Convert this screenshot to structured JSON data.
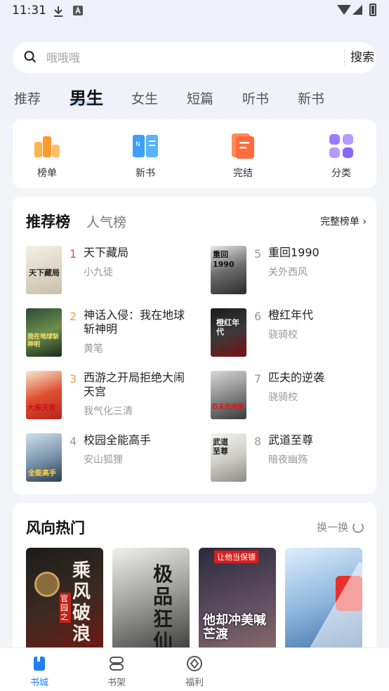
{
  "status_bar": {
    "time": "11:31"
  },
  "search": {
    "placeholder": "哦哦哦",
    "button": "搜索"
  },
  "tabs": [
    {
      "label": "推荐"
    },
    {
      "label": "男生",
      "active": true
    },
    {
      "label": "女生"
    },
    {
      "label": "短篇"
    },
    {
      "label": "听书"
    },
    {
      "label": "新书"
    }
  ],
  "quick_entries": [
    {
      "label": "榜单",
      "icon": "ranking-icon"
    },
    {
      "label": "新书",
      "icon": "new-book-icon"
    },
    {
      "label": "完结",
      "icon": "finished-icon"
    },
    {
      "label": "分类",
      "icon": "category-icon"
    }
  ],
  "ranking": {
    "tab_active": "推荐榜",
    "tab_other": "人气榜",
    "full_list": "完整榜单",
    "books": [
      {
        "rank": "1",
        "title": "天下藏局",
        "author": "小九徒",
        "cover_text": "天下藏局"
      },
      {
        "rank": "2",
        "title": "神话入侵：我在地球斩神明",
        "author": "黄笔",
        "cover_text": "我在地球斩神明"
      },
      {
        "rank": "3",
        "title": "西游之开局拒绝大闹天宫",
        "author": "我气化三清",
        "cover_text": "大闹天宫"
      },
      {
        "rank": "4",
        "title": "校园全能高手",
        "author": "安山狐狸",
        "cover_text": "全能高手"
      },
      {
        "rank": "5",
        "title": "重回1990",
        "author": "关外西风",
        "cover_text": "重回1990"
      },
      {
        "rank": "6",
        "title": "橙红年代",
        "author": "骁骑校",
        "cover_text": "橙红年代"
      },
      {
        "rank": "7",
        "title": "匹夫的逆袭",
        "author": "骁骑校",
        "cover_text": "匹夫的逆袭"
      },
      {
        "rank": "8",
        "title": "武道至尊",
        "author": "暗夜幽殇",
        "cover_text": "武道至尊"
      }
    ]
  },
  "trending": {
    "title": "风向热门",
    "refresh": "换一换",
    "posters": [
      {
        "text": "乘风破浪",
        "subtitle": "官园之"
      },
      {
        "text": "极品狂仙"
      },
      {
        "text": "他却冲美喊芒渡",
        "subtitle": "让他当保镖"
      },
      {
        "text": ""
      }
    ]
  },
  "bottom_nav": [
    {
      "label": "书城",
      "icon": "bookstore-icon",
      "active": true
    },
    {
      "label": "书架",
      "icon": "bookshelf-icon"
    },
    {
      "label": "福利",
      "icon": "rewards-icon"
    }
  ]
}
